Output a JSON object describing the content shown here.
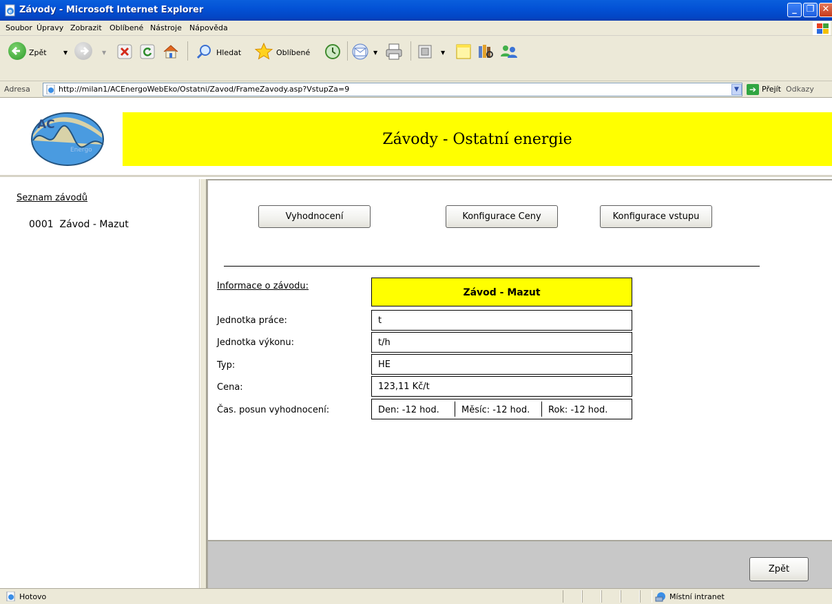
{
  "window": {
    "title": "Závody - Microsoft Internet Explorer",
    "minimize": "_",
    "maximize": "❐",
    "close": "✕"
  },
  "menu": {
    "items": [
      "Soubor",
      "Úpravy",
      "Zobrazit",
      "Oblíbené",
      "Nástroje",
      "Nápověda"
    ]
  },
  "toolbar": {
    "back_label": "Zpět",
    "search_label": "Hledat",
    "favorites_label": "Oblíbené"
  },
  "address": {
    "label": "Adresa",
    "url": "http://milan1/ACEnergoWebEko/Ostatni/Zavod/FrameZavody.asp?VstupZa=9",
    "go_label": "Přejít",
    "links_label": "Odkazy"
  },
  "header": {
    "logo_text": "AC",
    "logo_subtext": "Energo",
    "title": "Závody - Ostatní energie"
  },
  "sidebar": {
    "title": "Seznam závodů",
    "items": [
      {
        "label": "0001  Závod - Mazut"
      }
    ]
  },
  "actions": {
    "vyhodnoceni": "Vyhodnocení",
    "konfigurace_ceny": "Konfigurace Ceny",
    "konfigurace_vstupu": "Konfigurace vstupu",
    "back": "Zpět"
  },
  "info": {
    "section_label": "Informace o závodu:",
    "name": "Závod - Mazut",
    "rows": [
      {
        "label": "Jednotka práce:",
        "value": "t"
      },
      {
        "label": "Jednotka výkonu:",
        "value": "t/h"
      },
      {
        "label": "Typ:",
        "value": "HE"
      },
      {
        "label": "Cena:",
        "value": "123,11 Kč/t"
      }
    ],
    "shift_label": "Čas. posun vyhodnocení:",
    "shift": {
      "den": "Den: -12 hod.",
      "mesic": "Měsíc: -12 hod.",
      "rok": "Rok: -12 hod."
    }
  },
  "status": {
    "text": "Hotovo",
    "zone": "Místní intranet"
  },
  "colors": {
    "banner": "#ffff00",
    "titlebar": "#0352d6",
    "chrome": "#ece9d8",
    "footer": "#c8c8c8"
  }
}
